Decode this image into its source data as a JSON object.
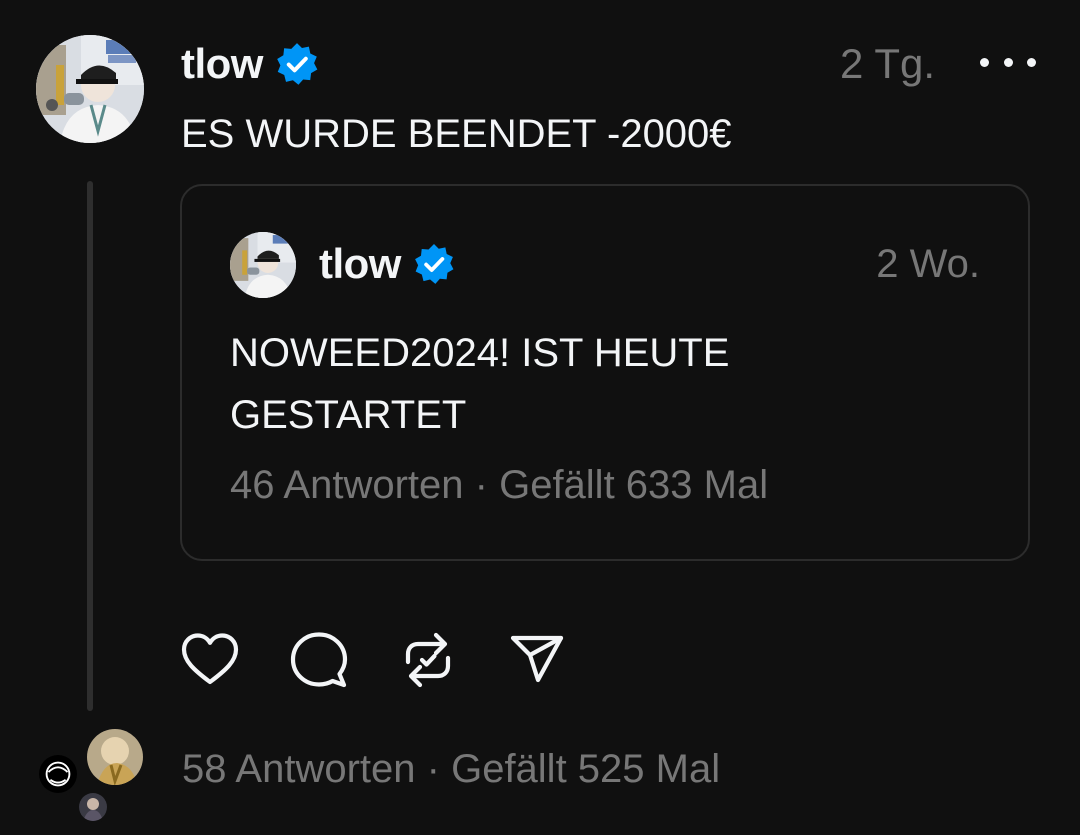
{
  "post": {
    "username": "tlow",
    "timestamp": "2 Tg.",
    "text": "ES WURDE BEENDET -2000€",
    "replies_label": "58 Antworten",
    "separator": "·",
    "likes_label": "Gefällt 525 Mal"
  },
  "quote": {
    "username": "tlow",
    "timestamp": "2 Wo.",
    "text_line1": "NOWEED2024! IST HEUTE",
    "text_line2": "GESTARTET",
    "replies_label": "46 Antworten",
    "separator": "·",
    "likes_label": "Gefällt 633 Mal"
  },
  "icons": {
    "verified": "verified-badge-icon",
    "more": "more-options-icon",
    "like": "heart-icon",
    "reply": "comment-bubble-icon",
    "repost": "repost-icon",
    "share": "send-icon"
  },
  "colors": {
    "background": "#101010",
    "text_primary": "#f3f5f7",
    "text_secondary": "#777777",
    "verified_blue": "#0095f6",
    "border": "#2c2c2c"
  }
}
